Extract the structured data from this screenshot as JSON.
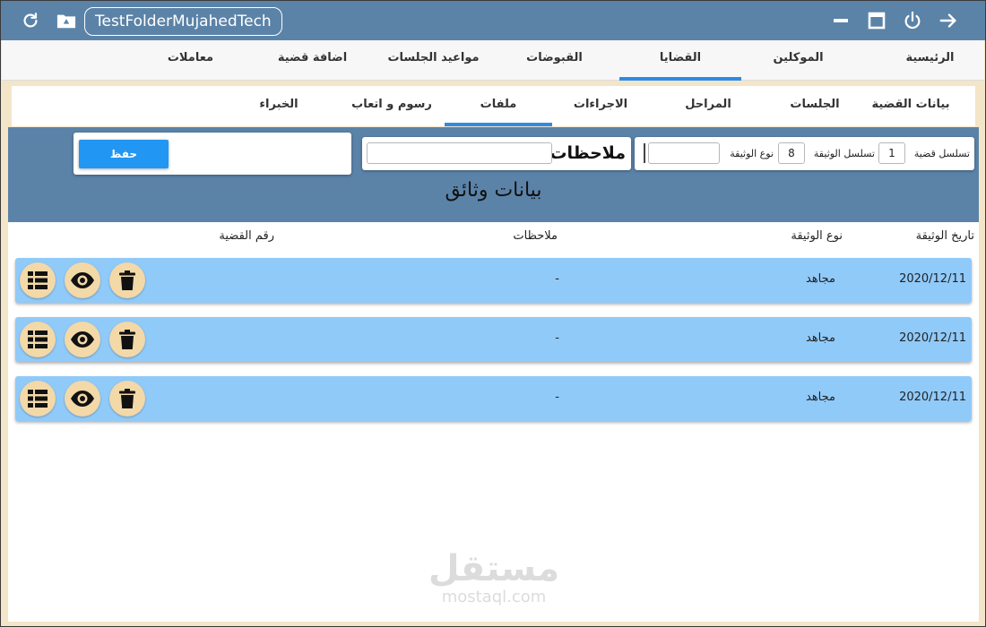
{
  "app": {
    "title": "TestFolderMujahedTech"
  },
  "main_tabs": [
    {
      "label": "الرئيسية"
    },
    {
      "label": "الموكلين"
    },
    {
      "label": "القضايا"
    },
    {
      "label": "القبوضات"
    },
    {
      "label": "مواعيد الجلسات"
    },
    {
      "label": "اضافة قضية"
    },
    {
      "label": "معاملات"
    }
  ],
  "main_active_tab": "القضايا",
  "sub_tabs": [
    {
      "label": "بيانات القضية"
    },
    {
      "label": "الجلسات"
    },
    {
      "label": "المراحل"
    },
    {
      "label": "الاجراءات"
    },
    {
      "label": "ملفات"
    },
    {
      "label": "رسوم و اتعاب"
    },
    {
      "label": "الخبراء"
    }
  ],
  "sub_active_tab": "ملفات",
  "form": {
    "case_seq_label": "تسلسل قضية",
    "case_seq_value": "1",
    "doc_seq_label": "تسلسل الوثيقة",
    "doc_seq_value": "8",
    "doc_type_label": "نوع الوثيقة",
    "doc_type_value": "",
    "notes_label": "ملاحظات",
    "notes_value": "",
    "save_label": "حفظ",
    "section_title": "بيانات وثائق"
  },
  "table": {
    "columns": [
      "تاريخ الوثيقة",
      "نوع الوثيقة",
      "ملاحظات",
      "رقم القضية"
    ],
    "rows": [
      {
        "date": "2020/12/11",
        "type": "مجاهد",
        "notes": "-"
      },
      {
        "date": "2020/12/11",
        "type": "مجاهد",
        "notes": "-"
      },
      {
        "date": "2020/12/11",
        "type": "مجاهد",
        "notes": "-"
      }
    ]
  },
  "icons": {
    "refresh": "refresh-icon",
    "folder": "folder-icon",
    "minimize": "minimize-icon",
    "maximize": "maximize-icon",
    "power": "power-icon",
    "exit": "arrow-right-icon",
    "row_list": "list-icon",
    "row_view": "eye-icon",
    "row_delete": "trash-icon"
  },
  "colors": {
    "titlebar": "#5b83a8",
    "accent": "#2f8ae8",
    "row": "#90caf9",
    "frame": "#f3e5c7",
    "action_circle": "#f3d8a8",
    "save_button": "#2196f3"
  },
  "watermark": {
    "arabic": "مستقل",
    "latin": "mostaql.com"
  }
}
